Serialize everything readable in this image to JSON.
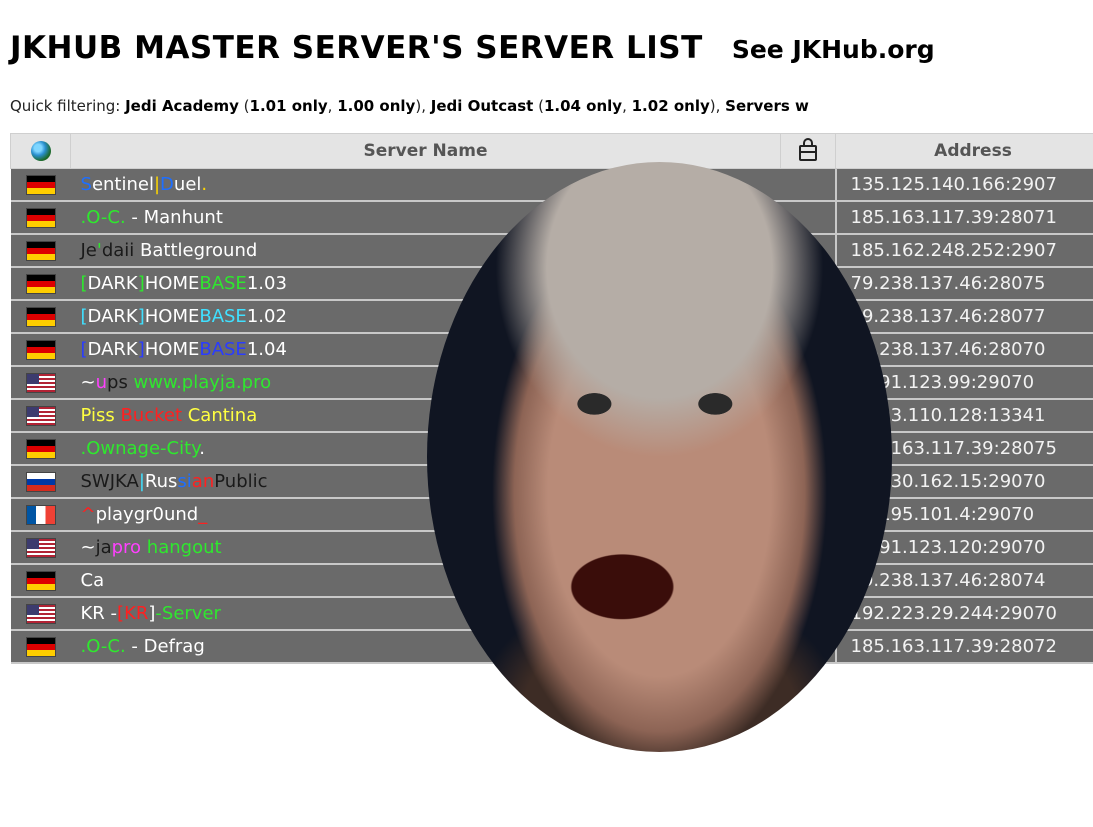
{
  "page": {
    "title": "JKHUB MASTER SERVER'S SERVER LIST",
    "link": "See JKHub.org"
  },
  "filter": {
    "label": "Quick filtering: ",
    "game1": "Jedi Academy",
    "game1_v1": "1.01 only",
    "game1_v2": "1.00 only",
    "game2": "Jedi Outcast",
    "game2_v1": "1.04 only",
    "game2_v2": "1.02 only",
    "more": "Servers w"
  },
  "table": {
    "columns": {
      "country_icon": "globe-icon",
      "name": "Server Name",
      "lock_icon": "lock-icon",
      "address": "Address"
    },
    "rows": [
      {
        "flag": "de",
        "parts": [
          [
            "S",
            "#1e6fff"
          ],
          [
            "entinel",
            "#ffffff"
          ],
          [
            "|",
            "#ffd700"
          ],
          [
            "D",
            "#1e6fff"
          ],
          [
            "uel",
            "#ffffff"
          ],
          [
            ".",
            "#ffd700"
          ]
        ],
        "address": "135.125.140.166:2907"
      },
      {
        "flag": "de",
        "parts": [
          [
            ".O-C.",
            "#2ee82e"
          ],
          [
            " - Manhunt",
            "#ffffff"
          ]
        ],
        "address": "185.163.117.39:28071"
      },
      {
        "flag": "de",
        "parts": [
          [
            "Je",
            "#1a1a1a"
          ],
          [
            "'",
            "#2ee82e"
          ],
          [
            "daii",
            "#1a1a1a"
          ],
          [
            " Battleground",
            "#ffffff"
          ]
        ],
        "address": "185.162.248.252:2907"
      },
      {
        "flag": "de",
        "parts": [
          [
            "[",
            "#2ee82e"
          ],
          [
            "DARK",
            "#ffffff"
          ],
          [
            "]",
            "#2ee82e"
          ],
          [
            "HOME",
            "#ffffff"
          ],
          [
            "BASE",
            "#2ee82e"
          ],
          [
            "1.03",
            "#ffffff"
          ]
        ],
        "address": "79.238.137.46:28075"
      },
      {
        "flag": "de",
        "parts": [
          [
            "[",
            "#40e0ff"
          ],
          [
            "DARK",
            "#ffffff"
          ],
          [
            "]",
            "#40e0ff"
          ],
          [
            "HOME",
            "#ffffff"
          ],
          [
            "BASE",
            "#40e0ff"
          ],
          [
            "1.02",
            "#ffffff"
          ]
        ],
        "address": "79.238.137.46:28077"
      },
      {
        "flag": "de",
        "parts": [
          [
            "[",
            "#2a3cff"
          ],
          [
            "DARK",
            "#ffffff"
          ],
          [
            "]",
            "#2a3cff"
          ],
          [
            "HOME",
            "#ffffff"
          ],
          [
            "BASE",
            "#2a3cff"
          ],
          [
            "1.04",
            "#ffffff"
          ]
        ],
        "address": "79.238.137.46:28070"
      },
      {
        "flag": "us",
        "parts": [
          [
            "~",
            "#ffffff"
          ],
          [
            "u",
            "#ff40ff"
          ],
          [
            "ps ",
            "#1a1a1a"
          ],
          [
            "www.playja.pro",
            "#2ee82e"
          ]
        ],
        "address": "74.91.123.99:29070"
      },
      {
        "flag": "us",
        "parts": [
          [
            "Piss ",
            "#ffff40"
          ],
          [
            "Bucket",
            "#ff2020"
          ],
          [
            " Cantina",
            "#ffff40"
          ]
        ],
        "address": "74.93.110.128:13341"
      },
      {
        "flag": "de",
        "parts": [
          [
            ".Ownage-City",
            "#2ee82e"
          ],
          [
            ".",
            "#ffffff"
          ]
        ],
        "address": "185.163.117.39:28075"
      },
      {
        "flag": "ru",
        "parts": [
          [
            "SWJKA",
            "#1a1a1a"
          ],
          [
            "|",
            "#40e0ff"
          ],
          [
            "Rus",
            "#ffffff"
          ],
          [
            "si",
            "#1e6fff"
          ],
          [
            "an",
            "#ff2020"
          ],
          [
            "Public",
            "#1a1a1a"
          ]
        ],
        "address": "37.230.162.15:29070"
      },
      {
        "flag": "fr",
        "parts": [
          [
            "^",
            "#ff2020"
          ],
          [
            "playgr0und",
            "#ffffff"
          ],
          [
            "_",
            "#ff2020"
          ]
        ],
        "address": "51.195.101.4:29070"
      },
      {
        "flag": "us",
        "parts": [
          [
            "~",
            "#ffffff"
          ],
          [
            "ja",
            "#1a1a1a"
          ],
          [
            "pro",
            "#ff40ff"
          ],
          [
            " hangout",
            "#2ee82e"
          ]
        ],
        "address": "74.91.123.120:29070"
      },
      {
        "flag": "de",
        "parts": [
          [
            "Ca",
            "#ffffff"
          ]
        ],
        "address": "79.238.137.46:28074"
      },
      {
        "flag": "us",
        "parts": [
          [
            "KR -",
            "#ffffff"
          ],
          [
            "[",
            "#ff2020"
          ],
          [
            "KR",
            "#ff2020"
          ],
          [
            "]",
            "#ffffff"
          ],
          [
            "-Server",
            "#2ee82e"
          ]
        ],
        "address": "192.223.29.244:29070"
      },
      {
        "flag": "de",
        "parts": [
          [
            ".O-C.",
            "#2ee82e"
          ],
          [
            " - Defrag",
            "#ffffff"
          ]
        ],
        "address": "185.163.117.39:28072"
      }
    ]
  }
}
